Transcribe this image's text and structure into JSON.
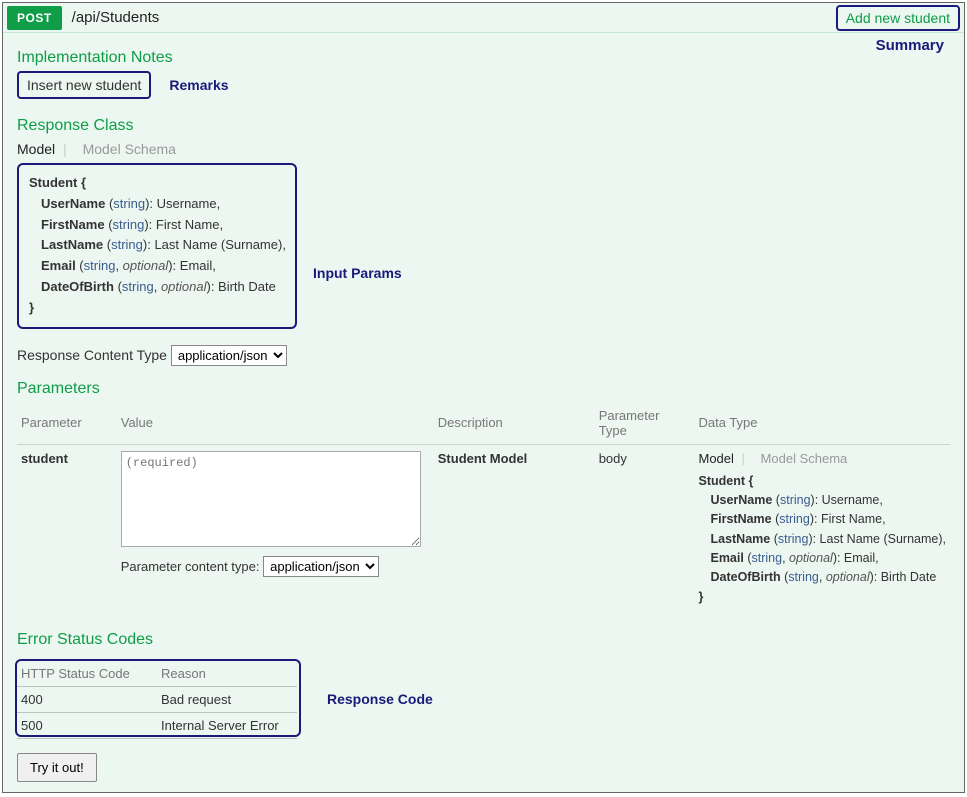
{
  "header": {
    "method": "POST",
    "path": "/api/Students",
    "summary_link": "Add new student"
  },
  "annotations": {
    "summary": "Summary",
    "remarks": "Remarks",
    "input_params": "Input Params",
    "response_code": "Response Code"
  },
  "sections": {
    "impl_notes_title": "Implementation Notes",
    "impl_notes_text": "Insert new student",
    "response_class_title": "Response Class",
    "tabs": {
      "model": "Model",
      "schema": "Model Schema"
    },
    "response_ct_label": "Response Content Type",
    "response_ct_value": "application/json",
    "parameters_title": "Parameters",
    "error_title": "Error Status Codes",
    "tryout": "Try it out!"
  },
  "model": {
    "name": "Student",
    "open": "Student {",
    "close": "}",
    "props": [
      {
        "name": "UserName",
        "type": "string",
        "optional": false,
        "desc": "Username"
      },
      {
        "name": "FirstName",
        "type": "string",
        "optional": false,
        "desc": "First Name"
      },
      {
        "name": "LastName",
        "type": "string",
        "optional": false,
        "desc": "Last Name (Surname)"
      },
      {
        "name": "Email",
        "type": "string",
        "optional": true,
        "desc": "Email"
      },
      {
        "name": "DateOfBirth",
        "type": "string",
        "optional": true,
        "desc": "Birth Date"
      }
    ]
  },
  "param_table": {
    "headers": {
      "parameter": "Parameter",
      "value": "Value",
      "description": "Description",
      "param_type": "Parameter Type",
      "data_type": "Data Type"
    },
    "row": {
      "parameter": "student",
      "value_placeholder": "(required)",
      "description": "Student Model",
      "param_type": "body"
    },
    "pct_label": "Parameter content type:",
    "pct_value": "application/json"
  },
  "errors": {
    "headers": {
      "code": "HTTP Status Code",
      "reason": "Reason"
    },
    "rows": [
      {
        "code": "400",
        "reason": "Bad request"
      },
      {
        "code": "500",
        "reason": "Internal Server Error"
      }
    ]
  }
}
